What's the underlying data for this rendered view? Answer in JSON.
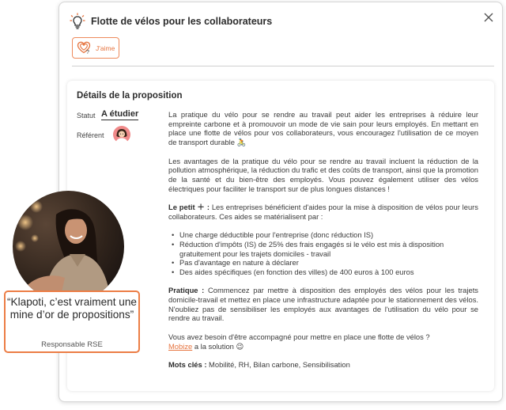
{
  "modal": {
    "title": "Flotte de vélos pour les collaborateurs",
    "like_label": "J'aime",
    "like_help": "?"
  },
  "details": {
    "heading": "Détails de la proposition",
    "statut_label": "Statut",
    "statut_value": "A étudier",
    "referent_label": "Référent",
    "p1": "La pratique du vélo pour se rendre au travail peut aider les entreprises à réduire leur empreinte carbone et à promouvoir un mode de vie sain pour leurs employés. En mettant en place une flotte de vélos pour vos collaborateurs, vous encouragez l'utilisation de ce moyen de transport durable 🚴",
    "p2": "Les avantages de la pratique du vélo pour se rendre au travail incluent la réduction de la pollution atmosphérique, la réduction du trafic et des coûts de transport, ainsi que la promotion de la santé et du bien-être des employés. Vous pouvez également utiliser des vélos électriques pour faciliter le transport sur de plus longues distances !",
    "plus_label": "Le petit ＋ :",
    "plus_text": " Les entreprises bénéficient d'aides pour la mise à disposition de vélos pour leurs collaborateurs. Ces aides se matérialisent par :",
    "bullets": [
      "Une charge déductible pour l'entreprise (donc réduction IS)",
      "Réduction d'impôts (IS) de 25% des frais engagés si le vélo est mis à disposition gratuitement pour les trajets domiciles - travail",
      "Pas d'avantage en nature à déclarer",
      "Des aides spécifiques (en fonction des villes) de 400 euros à 100 euros"
    ],
    "pratique_label": "Pratique :",
    "pratique_text": " Commencez par mettre à disposition des employés des vélos pour les trajets domicile-travail et mettez en place une infrastructure adaptée pour le stationnement des vélos. N'oubliez pas de sensibiliser les employés aux avantages de l'utilisation du vélo pour se rendre au travail.",
    "help_text": "Vous avez besoin d'être accompagné pour mettre en place une flotte de vélos ?",
    "help_link": "Mobize",
    "help_suffix": " a la solution 😉",
    "keywords_label": "Mots clés :",
    "keywords_text": " Mobilité, RH, Bilan carbone, Sensibilisation"
  },
  "testimonial": {
    "quote": "“Klapoti, c’est vraiment une mine d’or de propositions”",
    "author": "Responsable RSE"
  },
  "colors": {
    "accent": "#ec7d45",
    "text": "#3b3b3b",
    "border": "#d6d6d6"
  }
}
